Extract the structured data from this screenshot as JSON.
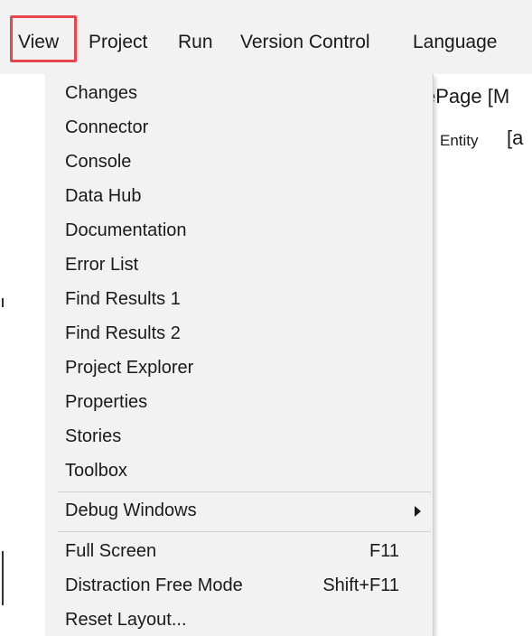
{
  "menubar": {
    "items": [
      {
        "label": "View"
      },
      {
        "label": "Project"
      },
      {
        "label": "Run"
      },
      {
        "label": "Version Control"
      },
      {
        "label": "Language"
      }
    ]
  },
  "background": {
    "title_fragment": "ePage [M",
    "entity_label": "Entity",
    "bracket_text": "[a"
  },
  "view_menu": {
    "items": [
      {
        "label": "Changes"
      },
      {
        "label": "Connector"
      },
      {
        "label": "Console"
      },
      {
        "label": "Data Hub"
      },
      {
        "label": "Documentation"
      },
      {
        "label": "Error List"
      },
      {
        "label": "Find Results 1"
      },
      {
        "label": "Find Results 2"
      },
      {
        "label": "Project Explorer"
      },
      {
        "label": "Properties"
      },
      {
        "label": "Stories"
      },
      {
        "label": "Toolbox"
      }
    ],
    "submenu": {
      "label": "Debug Windows"
    },
    "commands": [
      {
        "label": "Full Screen",
        "shortcut": "F11"
      },
      {
        "label": "Distraction Free Mode",
        "shortcut": "Shift+F11"
      },
      {
        "label": "Reset Layout..."
      }
    ]
  },
  "colors": {
    "highlight_border": "#e8454f",
    "menu_background": "#f2f2f2"
  }
}
